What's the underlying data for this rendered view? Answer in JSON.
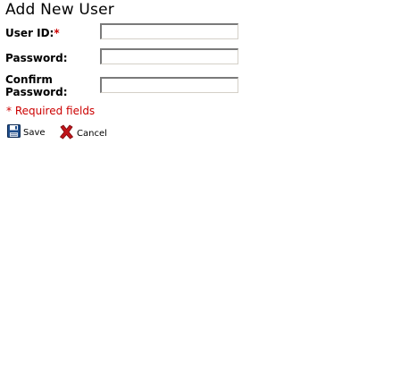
{
  "form": {
    "title": "Add New User",
    "fields": {
      "user_id": {
        "label": "User ID:",
        "required_mark": "*",
        "value": ""
      },
      "password": {
        "label": "Password:",
        "value": ""
      },
      "confirm_password": {
        "label_line1": "Confirm",
        "label_line2": "Password:",
        "value": ""
      }
    },
    "required_note": "* Required fields",
    "actions": {
      "save_label": "Save",
      "save_icon": "floppy-disk-icon",
      "cancel_label": "Cancel",
      "cancel_icon": "red-x-icon"
    }
  },
  "colors": {
    "required": "#cc0000",
    "input_border_dark": "#7a7a7a",
    "input_border_light": "#d4d0c8",
    "save_icon_blue": "#1f4e8c",
    "cancel_icon_red": "#c0141a"
  }
}
